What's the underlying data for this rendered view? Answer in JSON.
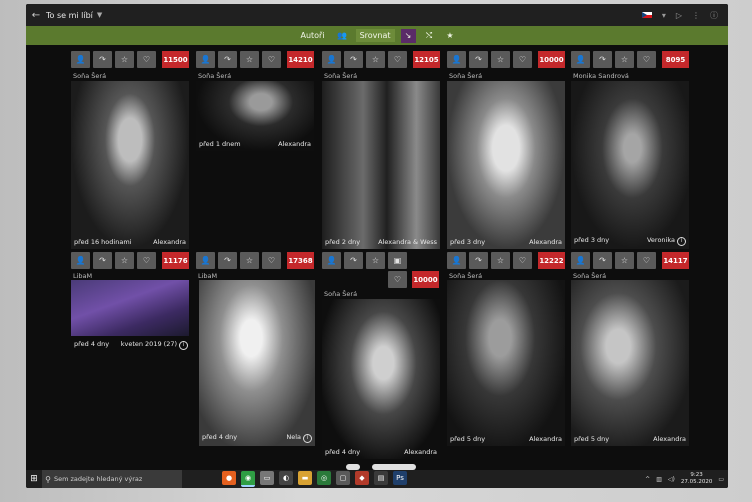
{
  "header": {
    "title": "To se mi líbí"
  },
  "toolbar": {
    "autori": "Autoři",
    "srovnat": "Srovnat"
  },
  "cards": [
    {
      "count": "11500",
      "author": "Soňa Šerá",
      "time": "před 16 hodinami",
      "model": "Alexandra",
      "info": false
    },
    {
      "count": "14210",
      "author": "Soňa Šerá",
      "time": "před 1 dnem",
      "model": "Alexandra",
      "info": false
    },
    {
      "count": "12105",
      "author": "Soňa Šerá",
      "time": "před 2 dny",
      "model": "Alexandra & Wess",
      "info": false
    },
    {
      "count": "10000",
      "author": "Soňa Šerá",
      "time": "před 3 dny",
      "model": "Alexandra",
      "info": false
    },
    {
      "count": "8095",
      "author": "Monika Sandrová",
      "time": "před 3 dny",
      "model": "Veronika",
      "info": true
    },
    {
      "count": "11176",
      "author": "LibaM",
      "time": "před 4 dny",
      "model": "kveten 2019 (27)",
      "info": true
    },
    {
      "count": "17368",
      "author": "LibaM",
      "time": "před 4 dny",
      "model": "Nela",
      "info": true
    },
    {
      "count": "10000",
      "author": "Soňa Šerá",
      "time": "před 4 dny",
      "model": "Alexandra",
      "info": false
    },
    {
      "count": "12222",
      "author": "Soňa Šerá",
      "time": "před 5 dny",
      "model": "Alexandra",
      "info": false
    },
    {
      "count": "14117",
      "author": "Soňa Šerá",
      "time": "před 5 dny",
      "model": "Alexandra",
      "info": false
    }
  ],
  "taskbar": {
    "search_placeholder": "Sem zadejte hledaný výraz",
    "time": "9:23",
    "date": "27.05.2020"
  },
  "colors": {
    "accent": "#5b7a2e",
    "badge": "#c4282b",
    "active_filter": "#5a2b68"
  }
}
